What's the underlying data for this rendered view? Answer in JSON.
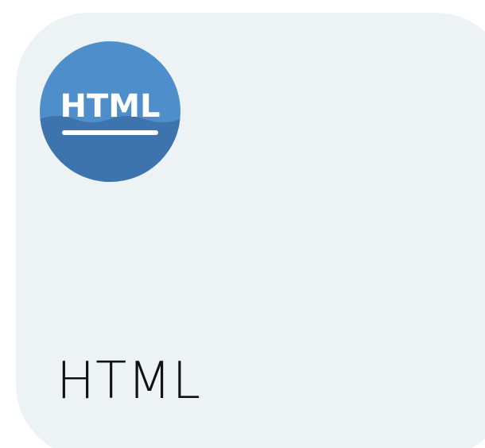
{
  "card": {
    "title": "HTML",
    "icon": {
      "name": "html-badge-icon",
      "label": "HTML",
      "color_top": "#4e8fcb",
      "color_bottom": "#3b72ad"
    },
    "background": "#edf3f4"
  }
}
